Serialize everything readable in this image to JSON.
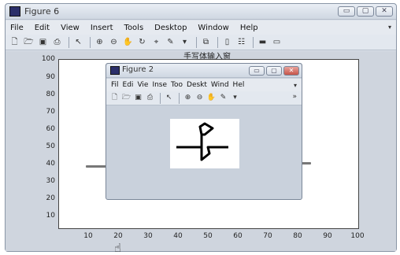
{
  "main_window": {
    "title": "Figure 6",
    "window_buttons": [
      "▭",
      "▢",
      "✕"
    ],
    "menu": [
      "File",
      "Edit",
      "View",
      "Insert",
      "Tools",
      "Desktop",
      "Window",
      "Help"
    ],
    "menu_overflow": "▾",
    "toolbar_icons": [
      "new-icon",
      "open-icon",
      "save-icon",
      "print-icon",
      "pointer-icon",
      "zoom-in-icon",
      "zoom-out-icon",
      "pan-icon",
      "rotate-icon",
      "datacursor-icon",
      "brush-icon",
      "link-icon",
      "colorbar-icon",
      "legend-icon",
      "hide-plot-tools-icon",
      "show-plot-tools-icon"
    ]
  },
  "plot": {
    "title": "手写体输入窗",
    "y_ticks": [
      "100",
      "90",
      "80",
      "70",
      "60",
      "50",
      "40",
      "30",
      "20",
      "10"
    ],
    "x_ticks": [
      "10",
      "20",
      "30",
      "40",
      "50",
      "60",
      "70",
      "80",
      "90",
      "100"
    ]
  },
  "figure2": {
    "title": "Figure 2",
    "window_buttons": [
      "▭",
      "▢",
      "✕"
    ],
    "menu": [
      "Fil",
      "Edi",
      "Vie",
      "Inse",
      "Too",
      "Deskt",
      "Wind",
      "Hel"
    ],
    "menu_overflow": "▾",
    "toolbar_overflow": "»",
    "toolbar_icons": [
      "new-icon",
      "open-icon",
      "save-icon",
      "print-icon",
      "pointer-icon",
      "zoom-in-icon",
      "zoom-out-icon",
      "pan-icon",
      "brush-icon"
    ]
  },
  "colors": {
    "window_frame": "#d9dfe8",
    "close_button": "#c5544a",
    "stroke": "#777777"
  }
}
